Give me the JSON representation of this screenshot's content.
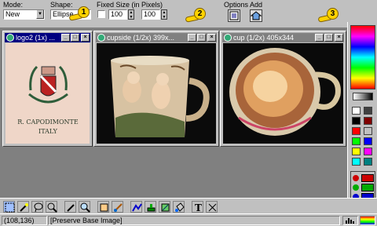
{
  "toolbar": {
    "mode_label": "Mode:",
    "mode_value": "New",
    "shape_label": "Shape:",
    "shape_value": "Ellipse",
    "fixed_label": "Fixed Size (in Pixels)",
    "width_value": "100",
    "height_value": "100",
    "options_label": "Options",
    "add_label": "Add",
    "hand1": "1",
    "hand2": "2",
    "hand3": "3"
  },
  "windows": {
    "logo": {
      "title": "logo2 (1x) ...",
      "plate_text_top": "R. CAPODIMONTE",
      "plate_text_bottom": "ITALY"
    },
    "cupside": {
      "title": "cupside (1/2x) 399x..."
    },
    "cup": {
      "title": "cup (1/2x) 405x344"
    }
  },
  "palette": {
    "swatches": [
      "#ffffff",
      "#404040",
      "#000000",
      "#800000",
      "#ff0000",
      "#c0c0c0",
      "#00ff00",
      "#0000ff",
      "#ffff00",
      "#ff00ff",
      "#00ffff",
      "#008080"
    ]
  },
  "status": {
    "coords": "(108,136)",
    "message": "[Preserve Base Image]"
  }
}
